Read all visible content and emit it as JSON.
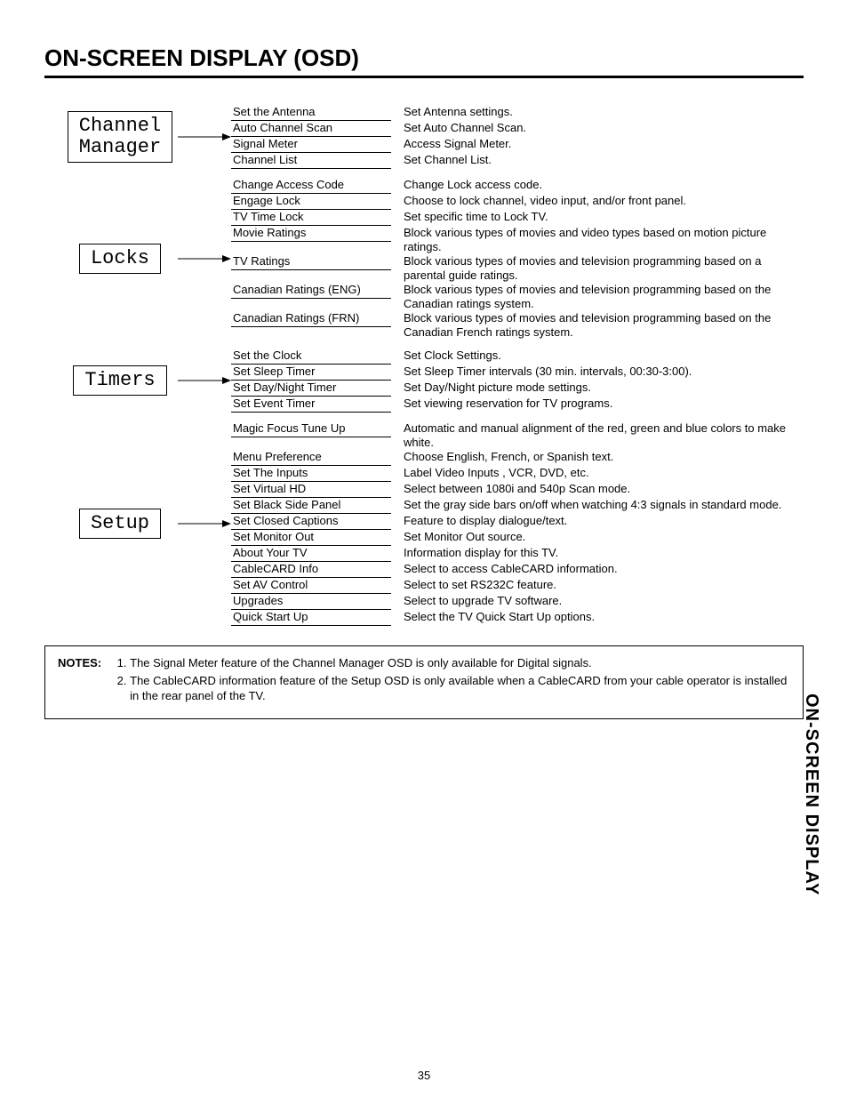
{
  "title": "ON-SCREEN DISPLAY (OSD)",
  "side_tab": "ON-SCREEN DISPLAY",
  "page_number": "35",
  "sections": [
    {
      "name": "Channel\nManager",
      "items": [
        {
          "label": "Set the Antenna",
          "desc": "Set Antenna settings."
        },
        {
          "label": "Auto Channel Scan",
          "desc": "Set Auto Channel Scan."
        },
        {
          "label": "Signal Meter",
          "desc": "Access Signal Meter."
        },
        {
          "label": "Channel List",
          "desc": "Set Channel List."
        }
      ]
    },
    {
      "name": "Locks",
      "items": [
        {
          "label": "Change Access Code",
          "desc": "Change Lock access code."
        },
        {
          "label": "Engage Lock",
          "desc": "Choose to lock channel, video input, and/or front panel."
        },
        {
          "label": "TV Time Lock",
          "desc": "Set specific time to Lock TV."
        },
        {
          "label": "Movie Ratings",
          "desc": "Block various types of movies and video types based on motion picture ratings."
        },
        {
          "label": "TV Ratings",
          "desc": "Block various types of movies and television programming based on a parental guide ratings."
        },
        {
          "label": "Canadian Ratings (ENG)",
          "desc": "Block various types of movies and television programming based on the Canadian ratings system."
        },
        {
          "label": "Canadian Ratings (FRN)",
          "desc": "Block various types of movies and television programming based on the Canadian French ratings system."
        }
      ]
    },
    {
      "name": "Timers",
      "items": [
        {
          "label": "Set the Clock",
          "desc": "Set Clock Settings."
        },
        {
          "label": "Set Sleep Timer",
          "desc": "Set Sleep Timer intervals (30 min. intervals, 00:30-3:00)."
        },
        {
          "label": "Set Day/Night Timer",
          "desc": "Set Day/Night picture mode settings."
        },
        {
          "label": "Set Event Timer",
          "desc": "Set viewing reservation for TV programs."
        }
      ]
    },
    {
      "name": "Setup",
      "items": [
        {
          "label": "Magic Focus Tune Up",
          "desc": "Automatic and manual alignment of the red, green and blue colors to make white."
        },
        {
          "label": "Menu Preference",
          "desc": "Choose English, French, or Spanish text."
        },
        {
          "label": "Set The Inputs",
          "desc": "Label Video Inputs , VCR, DVD, etc."
        },
        {
          "label": "Set Virtual HD",
          "desc": "Select between 1080i and 540p Scan mode."
        },
        {
          "label": "Set Black Side Panel",
          "desc": "Set the gray side bars on/off when watching 4:3 signals in standard mode."
        },
        {
          "label": "Set Closed Captions",
          "desc": "Feature to display dialogue/text."
        },
        {
          "label": "Set Monitor Out",
          "desc": "Set Monitor Out source."
        },
        {
          "label": "About Your TV",
          "desc": "Information display for this TV."
        },
        {
          "label": "CableCARD Info",
          "desc": "Select to access CableCARD information."
        },
        {
          "label": "Set AV Control",
          "desc": "Select to set RS232C feature."
        },
        {
          "label": "Upgrades",
          "desc": "Select to upgrade TV software."
        },
        {
          "label": "Quick Start Up",
          "desc": "Select the TV Quick Start Up options."
        }
      ]
    }
  ],
  "notes": {
    "label": "NOTES:",
    "items": [
      "The Signal Meter feature of the Channel Manager OSD is only available for Digital signals.",
      "The CableCARD information feature of the Setup OSD is only available when a CableCARD from your cable operator is installed in the rear panel of the TV."
    ]
  }
}
